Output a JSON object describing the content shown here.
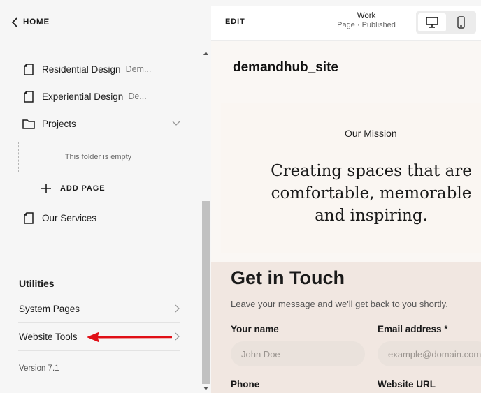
{
  "nav": {
    "home_label": "HOME"
  },
  "pages": [
    {
      "name": "Residential Design",
      "desc": "Dem..."
    },
    {
      "name": "Experiential Design",
      "desc": "De..."
    },
    {
      "name": "Projects",
      "desc": ""
    },
    {
      "name": "Our Services",
      "desc": ""
    }
  ],
  "folder": {
    "empty_text": "This folder is empty",
    "add_page_label": "ADD PAGE"
  },
  "utilities": {
    "title": "Utilities",
    "items": [
      {
        "label": "System Pages"
      },
      {
        "label": "Website Tools"
      }
    ]
  },
  "version": "Version 7.1",
  "topbar": {
    "edit_label": "EDIT",
    "page_name": "Work",
    "page_status": "Page · Published"
  },
  "preview": {
    "site_name": "demandhub_site",
    "mission_label": "Our Mission",
    "mission_quote": "Creating spaces that are comfortable, memorable and inspiring.",
    "contact": {
      "title": "Get in Touch",
      "subtitle": "Leave your message and we'll get back to you shortly.",
      "name_label": "Your name",
      "name_placeholder": "John Doe",
      "email_label": "Email address *",
      "email_placeholder": "example@domain.com",
      "phone_label": "Phone",
      "website_label": "Website URL"
    }
  },
  "colors": {
    "arrow": "#e00f16",
    "panel_bg": "#f6f6f6",
    "contact_bg": "#f1e7e1"
  }
}
